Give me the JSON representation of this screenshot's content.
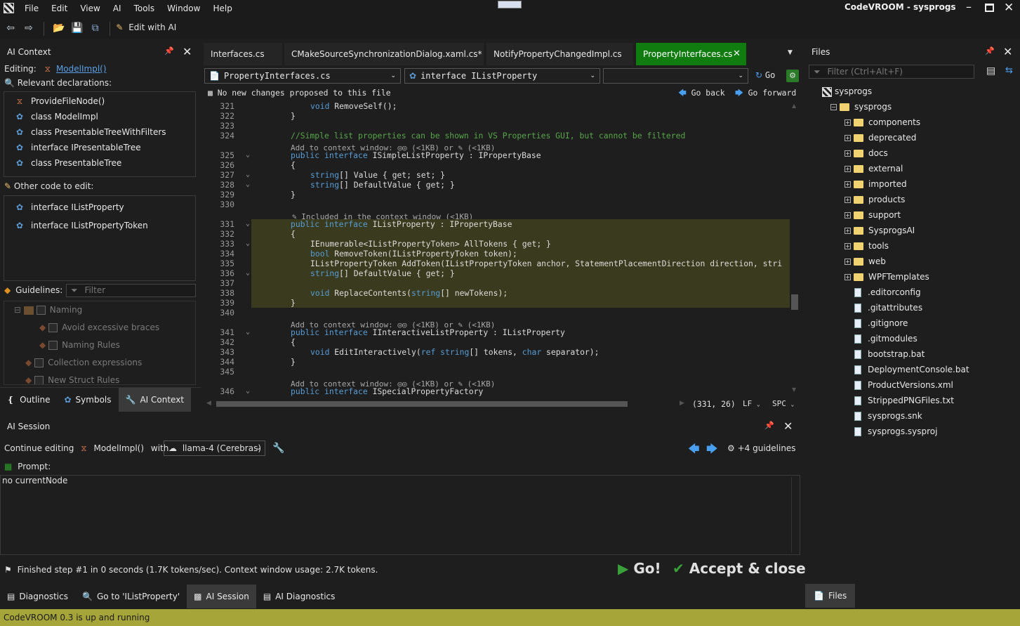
{
  "window": {
    "title": "CodeVROOM - sysprogs"
  },
  "menu": [
    "File",
    "Edit",
    "View",
    "AI",
    "Tools",
    "Window",
    "Help"
  ],
  "toolbar": {
    "edit_ai_label": "Edit with AI"
  },
  "ai_context": {
    "title": "AI Context",
    "editing_label": "Editing:",
    "editing_target": "ModelImpl()",
    "relevant_label": "Relevant declarations:",
    "relevant": [
      {
        "label": "ProvideFileNode()",
        "icon": "method-icon"
      },
      {
        "label": "class ModelImpl",
        "icon": "class-icon"
      },
      {
        "label": "class PresentableTreeWithFilters",
        "icon": "class-icon"
      },
      {
        "label": "interface IPresentableTree",
        "icon": "interface-icon"
      },
      {
        "label": "class PresentableTree",
        "icon": "class-icon"
      }
    ],
    "other_label": "Other code to edit:",
    "other": [
      {
        "label": "interface IListProperty"
      },
      {
        "label": "interface IListPropertyToken"
      }
    ],
    "guidelines_label": "Guidelines:",
    "filter_placeholder": "Filter",
    "guidelines": [
      {
        "label": "Naming",
        "level": 0
      },
      {
        "label": "Avoid excessive braces",
        "level": 1
      },
      {
        "label": "Naming Rules",
        "level": 1
      },
      {
        "label": "Collection expressions",
        "level": 0
      },
      {
        "label": "New Struct Rules",
        "level": 0
      }
    ],
    "tabs": [
      "Outline",
      "Symbols",
      "AI Context"
    ]
  },
  "editor": {
    "tabs": [
      "Interfaces.cs",
      "CMakeSourceSynchronizationDialog.xaml.cs*",
      "NotifyPropertyChangedImpl.cs",
      "PropertyInterfaces.cs"
    ],
    "file_combo": "PropertyInterfaces.cs",
    "symbol_combo": "interface IListProperty",
    "go_label": "Go",
    "status_msg": "No new changes proposed to this file",
    "go_back": "Go back",
    "go_forward": "Go forward",
    "position": "(331, 26)",
    "line_ending": "LF",
    "indent": "SPC",
    "ann_add": "Add to context window:",
    "ann_size": "(<1KB)",
    "ann_or": "or",
    "ann_included": "Included in the context window (<1KB)",
    "lines": [
      {
        "n": "321",
        "indent": 2,
        "parts": [
          [
            "kw",
            "void"
          ],
          [
            "t",
            " RemoveSelf();"
          ]
        ]
      },
      {
        "n": "322",
        "indent": 1,
        "parts": [
          [
            "t",
            "}"
          ]
        ]
      },
      {
        "n": "323",
        "indent": 0,
        "parts": []
      },
      {
        "n": "324",
        "indent": 1,
        "parts": [
          [
            "cm",
            "//Simple list properties can be shown in VS Properties GUI, but cannot be filtered"
          ]
        ]
      },
      {
        "ann": "add"
      },
      {
        "n": "325",
        "indent": 1,
        "fold": "v",
        "parts": [
          [
            "kw",
            "public interface"
          ],
          [
            "t",
            " ISimpleListProperty : IPropertyBase"
          ]
        ]
      },
      {
        "n": "326",
        "indent": 1,
        "parts": [
          [
            "t",
            "{"
          ]
        ]
      },
      {
        "n": "327",
        "indent": 2,
        "fold": "v",
        "parts": [
          [
            "kw",
            "string"
          ],
          [
            "t",
            "[] Value { get; set; }"
          ]
        ]
      },
      {
        "n": "328",
        "indent": 2,
        "fold": "v",
        "parts": [
          [
            "kw",
            "string"
          ],
          [
            "t",
            "[] DefaultValue { get; }"
          ]
        ]
      },
      {
        "n": "329",
        "indent": 1,
        "parts": [
          [
            "t",
            "}"
          ]
        ]
      },
      {
        "n": "330",
        "indent": 0,
        "parts": []
      },
      {
        "ann": "included"
      },
      {
        "n": "331",
        "indent": 1,
        "fold": "v",
        "hl": true,
        "parts": [
          [
            "kw",
            "public interface"
          ],
          [
            "t",
            " IListProperty : IPropertyBase"
          ]
        ]
      },
      {
        "n": "332",
        "indent": 1,
        "hl": true,
        "parts": [
          [
            "t",
            "{"
          ]
        ]
      },
      {
        "n": "333",
        "indent": 2,
        "fold": "v",
        "hl": true,
        "parts": [
          [
            "t",
            "IEnumerable<IListPropertyToken> AllTokens { get; }"
          ]
        ]
      },
      {
        "n": "334",
        "indent": 2,
        "hl": true,
        "parts": [
          [
            "kw",
            "bool"
          ],
          [
            "t",
            " RemoveToken(IListPropertyToken token);"
          ]
        ]
      },
      {
        "n": "335",
        "indent": 2,
        "hl": true,
        "parts": [
          [
            "t",
            "IListPropertyToken AddToken(IListPropertyToken anchor, StatementPlacementDirection direction, stri"
          ]
        ]
      },
      {
        "n": "336",
        "indent": 2,
        "fold": "v",
        "hl": true,
        "parts": [
          [
            "kw",
            "string"
          ],
          [
            "t",
            "[] DefaultValue { get; }"
          ]
        ]
      },
      {
        "n": "337",
        "indent": 0,
        "hl": true,
        "parts": []
      },
      {
        "n": "338",
        "indent": 2,
        "hl": true,
        "parts": [
          [
            "kw",
            "void"
          ],
          [
            "t",
            " ReplaceContents("
          ],
          [
            "kw",
            "string"
          ],
          [
            "t",
            "[] newTokens);"
          ]
        ]
      },
      {
        "n": "339",
        "indent": 1,
        "hl": true,
        "parts": [
          [
            "t",
            "}"
          ]
        ]
      },
      {
        "n": "340",
        "indent": 0,
        "parts": []
      },
      {
        "ann": "add"
      },
      {
        "n": "341",
        "indent": 1,
        "fold": "v",
        "parts": [
          [
            "kw",
            "public interface"
          ],
          [
            "t",
            " IInteractiveListProperty : IListProperty"
          ]
        ]
      },
      {
        "n": "342",
        "indent": 1,
        "parts": [
          [
            "t",
            "{"
          ]
        ]
      },
      {
        "n": "343",
        "indent": 2,
        "parts": [
          [
            "kw",
            "void"
          ],
          [
            "t",
            " EditInteractively("
          ],
          [
            "kw",
            "ref string"
          ],
          [
            "t",
            "[] tokens, "
          ],
          [
            "kw",
            "char"
          ],
          [
            "t",
            " separator);"
          ]
        ]
      },
      {
        "n": "344",
        "indent": 1,
        "parts": [
          [
            "t",
            "}"
          ]
        ]
      },
      {
        "n": "345",
        "indent": 0,
        "parts": []
      },
      {
        "ann": "add"
      },
      {
        "n": "346",
        "indent": 1,
        "fold": "v",
        "parts": [
          [
            "kw",
            "public interface"
          ],
          [
            "t",
            " ISpecialPropertyFactory"
          ]
        ]
      }
    ]
  },
  "files": {
    "title": "Files",
    "filter_placeholder": "Filter (Ctrl+Alt+F)",
    "root": "sysprogs",
    "project": "sysprogs",
    "folders": [
      "components",
      "deprecated",
      "docs",
      "external",
      "imported",
      "products",
      "support",
      "SysprogsAI",
      "tools",
      "web",
      "WPFTemplates"
    ],
    "items": [
      ".editorconfig",
      ".gitattributes",
      ".gitignore",
      ".gitmodules",
      "bootstrap.bat",
      "DeploymentConsole.bat",
      "ProductVersions.xml",
      "StrippedPNGFiles.txt",
      "sysprogs.snk",
      "sysprogs.sysproj"
    ],
    "tab": "Files"
  },
  "ai_session": {
    "title": "AI Session",
    "continue_label": "Continue editing",
    "target": "ModelImpl()",
    "with_label": "with",
    "model": "llama-4 (Cerebras)",
    "guidelines_count": "+4 guidelines",
    "prompt_label": "Prompt:",
    "prompt_text": "no currentNode",
    "status": "Finished step #1 in 0 seconds (1.7K tokens/sec). Context window usage: 2.7K tokens.",
    "go_label": "Go!",
    "accept_label": "Accept & close"
  },
  "bottom_tabs": [
    "Diagnostics",
    "Go to 'IListProperty'",
    "AI Session",
    "AI Diagnostics"
  ],
  "statusbar": {
    "text": "CodeVROOM 0.3 is up and running"
  },
  "colors": {
    "accent_green": "#107c10",
    "status_bar": "#a5a53a",
    "highlight": "#3a3a1e"
  }
}
